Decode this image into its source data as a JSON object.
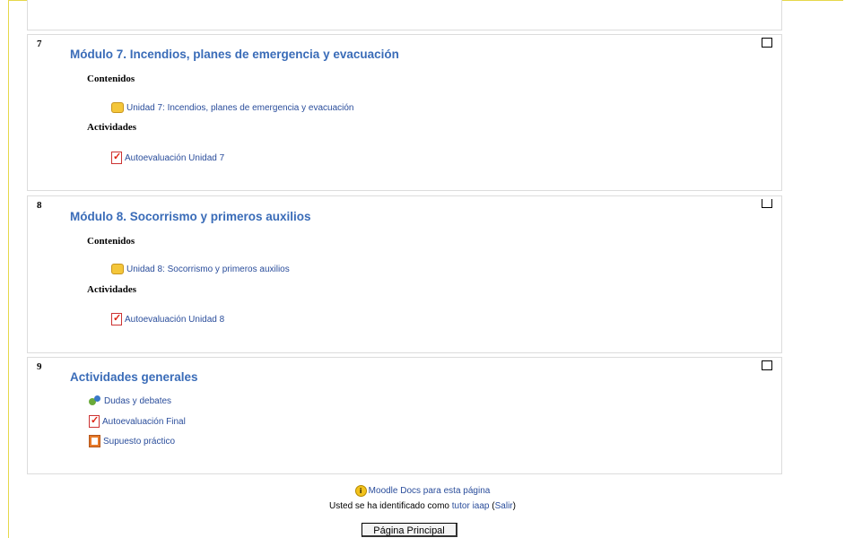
{
  "sections": [
    {
      "number": "7",
      "title": "Módulo 7. Incendios, planes de emergencia y evacuación",
      "contents_label": "Contenidos",
      "contents_items": [
        "Unidad 7: Incendios, planes de emergencia y evacuación"
      ],
      "activities_label": "Actividades",
      "activities_items": [
        "Autoevaluación Unidad 7"
      ]
    },
    {
      "number": "8",
      "title": "Módulo 8. Socorrismo y primeros auxilios",
      "contents_label": "Contenidos",
      "contents_items": [
        "Unidad 8: Socorrismo y primeros auxilios"
      ],
      "activities_label": "Actividades",
      "activities_items": [
        "Autoevaluación Unidad 8"
      ]
    },
    {
      "number": "9",
      "title": "Actividades generales",
      "items": [
        {
          "label": "Dudas y debates",
          "icon": "forum-icon"
        },
        {
          "label": "Autoevaluación Final",
          "icon": "quiz-icon"
        },
        {
          "label": "Supuesto práctico",
          "icon": "assignment-icon"
        }
      ]
    }
  ],
  "footer": {
    "docs_link": "Moodle Docs para esta página",
    "login_prefix": "Usted se ha identificado como",
    "user_name": "tutor iaap",
    "logout_open": "(",
    "logout_label": "Salir",
    "logout_close": ")",
    "home_button": "Página Principal"
  },
  "colors": {
    "link": "#2a4d9b",
    "section_title": "#3a6cb8",
    "frame_border": "#e6d84a"
  }
}
